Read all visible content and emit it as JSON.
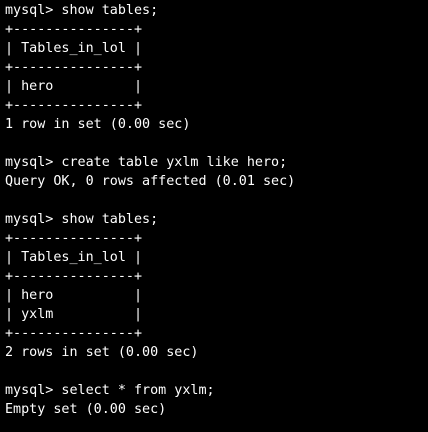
{
  "terminal": {
    "lines": [
      "mysql> show tables;",
      "+---------------+",
      "| Tables_in_lol |",
      "+---------------+",
      "| hero          |",
      "+---------------+",
      "1 row in set (0.00 sec)",
      "",
      "mysql> create table yxlm like hero;",
      "Query OK, 0 rows affected (0.01 sec)",
      "",
      "mysql> show tables;",
      "+---------------+",
      "| Tables_in_lol |",
      "+---------------+",
      "| hero          |",
      "| yxlm          |",
      "+---------------+",
      "2 rows in set (0.00 sec)",
      "",
      "mysql> select * from yxlm;",
      "Empty set (0.00 sec)"
    ]
  }
}
